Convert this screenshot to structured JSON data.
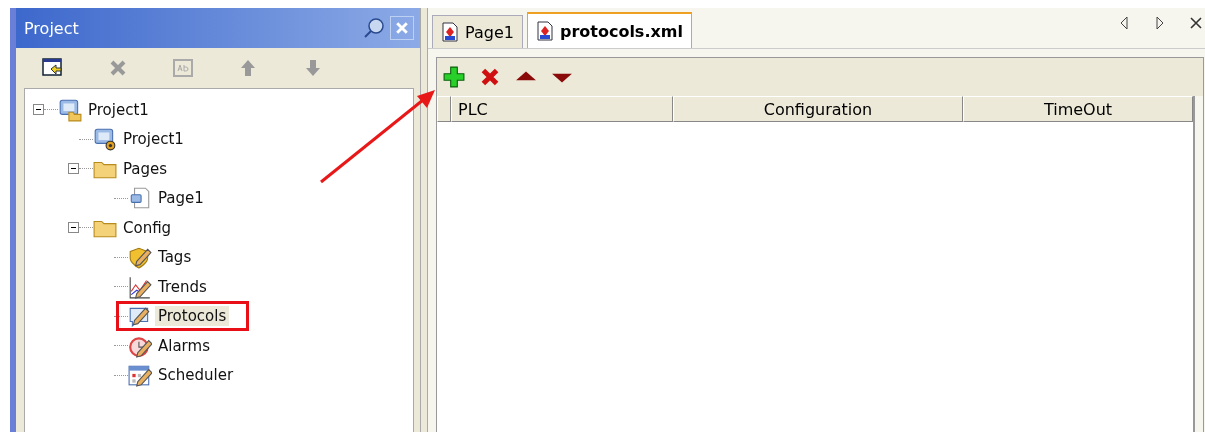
{
  "project_panel": {
    "title": "Project",
    "tree": [
      {
        "label": "Project1",
        "kind": "project",
        "expanded": true,
        "selected": false,
        "outlined": false,
        "children": [
          {
            "label": "Project1",
            "kind": "settings",
            "selected": false,
            "outlined": false
          },
          {
            "label": "Pages",
            "kind": "folder",
            "expanded": true,
            "selected": false,
            "outlined": false,
            "children": [
              {
                "label": "Page1",
                "kind": "page",
                "selected": false,
                "outlined": false
              }
            ]
          },
          {
            "label": "Config",
            "kind": "folder",
            "expanded": true,
            "selected": false,
            "outlined": false,
            "children": [
              {
                "label": "Tags",
                "kind": "tags",
                "selected": false,
                "outlined": false
              },
              {
                "label": "Trends",
                "kind": "trends",
                "selected": false,
                "outlined": false
              },
              {
                "label": "Protocols",
                "kind": "protocols",
                "selected": true,
                "outlined": true
              },
              {
                "label": "Alarms",
                "kind": "alarms",
                "selected": false,
                "outlined": false
              },
              {
                "label": "Scheduler",
                "kind": "scheduler",
                "selected": false,
                "outlined": false
              }
            ]
          }
        ]
      }
    ]
  },
  "tabs": [
    {
      "label": "Page1",
      "selected": false
    },
    {
      "label": "protocols.xml",
      "selected": true
    }
  ],
  "table": {
    "columns": [
      "PLC",
      "Configuration",
      "TimeOut"
    ]
  }
}
